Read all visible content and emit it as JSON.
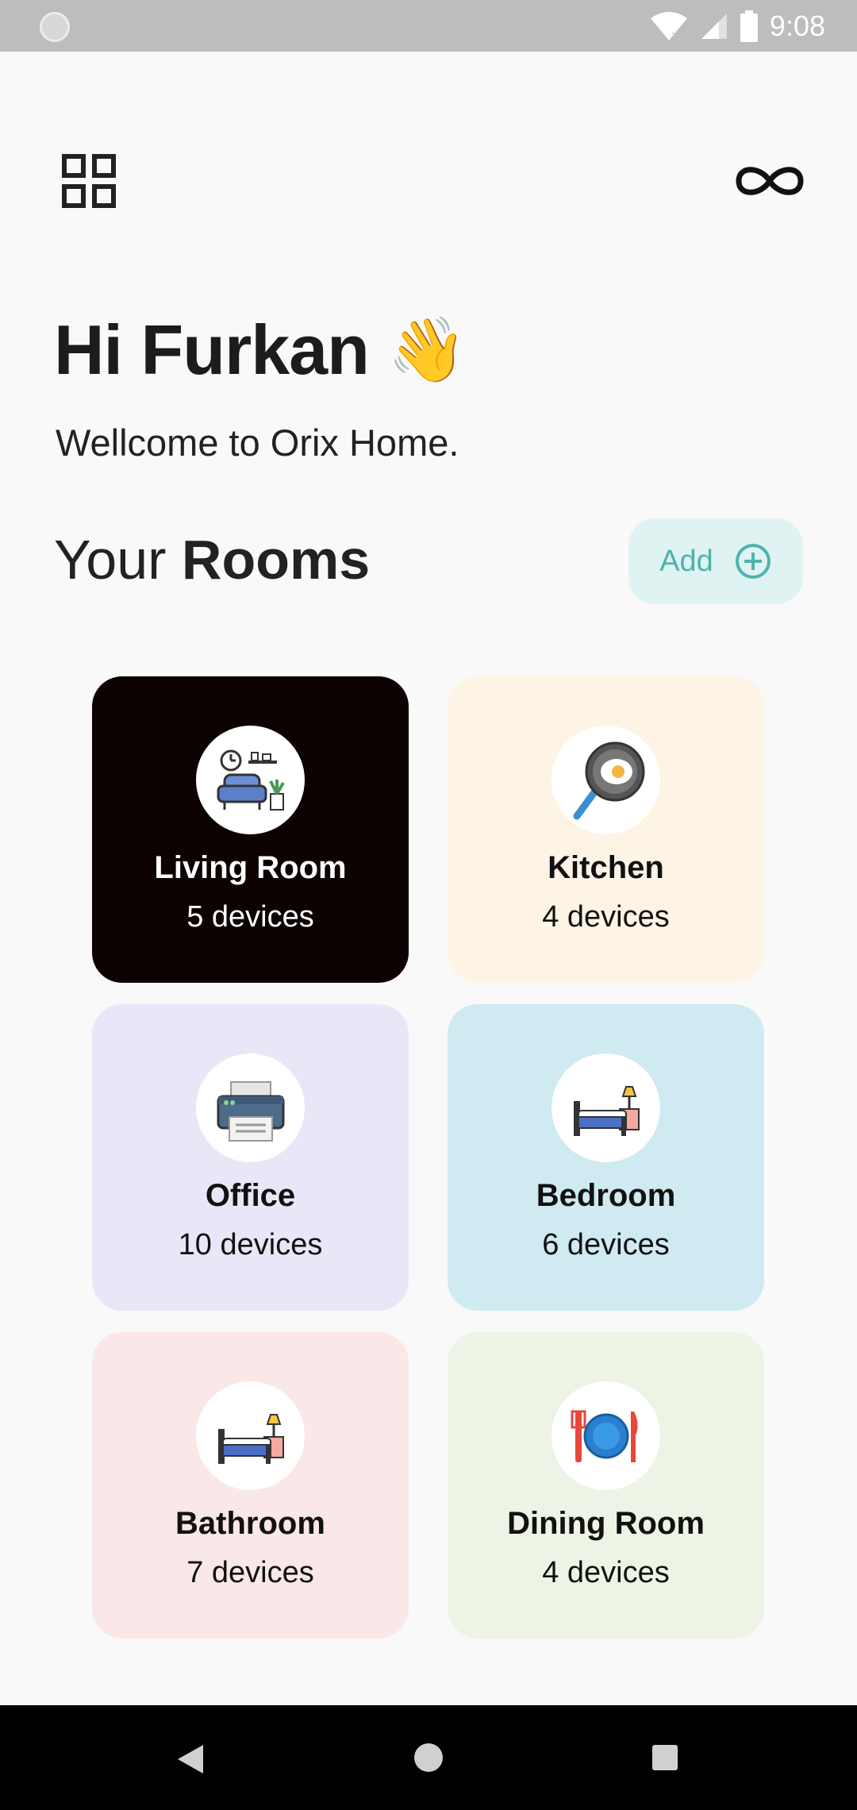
{
  "status_bar": {
    "time": "9:08"
  },
  "header": {
    "menu_icon": "grid-icon",
    "link_icon": "infinity-icon"
  },
  "greeting": {
    "text": "Hi Furkan",
    "emoji": "👋"
  },
  "welcome": "Wellcome to Orix Home.",
  "rooms_section": {
    "heading_prefix": "Your",
    "heading_bold": "Rooms",
    "add_label": "Add",
    "add_icon": "plus-circle-icon"
  },
  "rooms": [
    {
      "name": "Living Room",
      "count": "5 devices",
      "icon": "armchair-icon",
      "bg": "#0d0202",
      "fg": "#ffffff"
    },
    {
      "name": "Kitchen",
      "count": "4 devices",
      "icon": "frying-pan-icon",
      "bg": "#fef4e6",
      "fg": "#111111"
    },
    {
      "name": "Office",
      "count": "10 devices",
      "icon": "printer-icon",
      "bg": "#e9e6f7",
      "fg": "#111111"
    },
    {
      "name": "Bedroom",
      "count": "6 devices",
      "icon": "bed-icon",
      "bg": "#cfeaf1",
      "fg": "#111111"
    },
    {
      "name": "Bathroom",
      "count": "7 devices",
      "icon": "bed-icon",
      "bg": "#f9e8e7",
      "fg": "#111111"
    },
    {
      "name": "Dining Room",
      "count": "4 devices",
      "icon": "plate-cutlery-icon",
      "bg": "#eef4e5",
      "fg": "#111111"
    }
  ],
  "colors": {
    "accent": "#4fb3ad",
    "add_bg": "#dff3f2",
    "background": "#f9f9f9"
  },
  "nav_bar": {
    "back_icon": "back-triangle-icon",
    "home_icon": "home-circle-icon",
    "recents_icon": "recents-square-icon"
  }
}
